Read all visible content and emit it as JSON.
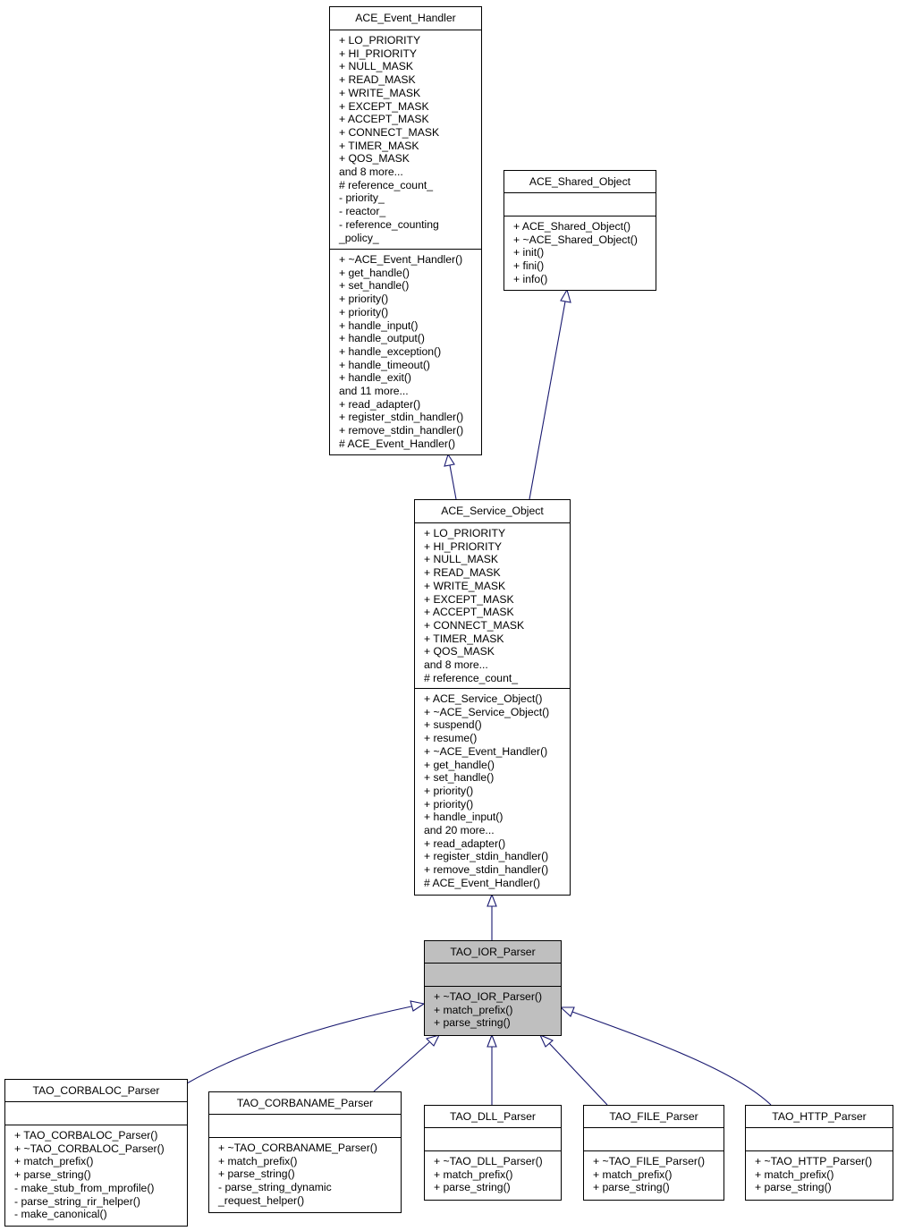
{
  "diagram": {
    "type": "class-inheritance-graph",
    "focus_class": "TAO_IOR_Parser",
    "edge_color": "#191970",
    "focus_fill": "#bfbfbf",
    "classes": {
      "ace_event_handler": {
        "name": "ACE_Event_Handler",
        "attributes": [
          "+ LO_PRIORITY",
          "+ HI_PRIORITY",
          "+ NULL_MASK",
          "+ READ_MASK",
          "+ WRITE_MASK",
          "+ EXCEPT_MASK",
          "+ ACCEPT_MASK",
          "+ CONNECT_MASK",
          "+ TIMER_MASK",
          "+ QOS_MASK",
          "and 8 more...",
          "# reference_count_",
          "- priority_",
          "- reactor_",
          "- reference_counting",
          "_policy_"
        ],
        "methods": [
          "+ ~ACE_Event_Handler()",
          "+ get_handle()",
          "+ set_handle()",
          "+ priority()",
          "+ priority()",
          "+ handle_input()",
          "+ handle_output()",
          "+ handle_exception()",
          "+ handle_timeout()",
          "+ handle_exit()",
          "and 11 more...",
          "+ read_adapter()",
          "+ register_stdin_handler()",
          "+ remove_stdin_handler()",
          "# ACE_Event_Handler()"
        ]
      },
      "ace_shared_object": {
        "name": "ACE_Shared_Object",
        "attributes": [],
        "methods": [
          "+ ACE_Shared_Object()",
          "+ ~ACE_Shared_Object()",
          "+ init()",
          "+ fini()",
          "+ info()"
        ]
      },
      "ace_service_object": {
        "name": "ACE_Service_Object",
        "attributes": [
          "+ LO_PRIORITY",
          "+ HI_PRIORITY",
          "+ NULL_MASK",
          "+ READ_MASK",
          "+ WRITE_MASK",
          "+ EXCEPT_MASK",
          "+ ACCEPT_MASK",
          "+ CONNECT_MASK",
          "+ TIMER_MASK",
          "+ QOS_MASK",
          "and 8 more...",
          "# reference_count_"
        ],
        "methods": [
          "+ ACE_Service_Object()",
          "+ ~ACE_Service_Object()",
          "+ suspend()",
          "+ resume()",
          "+ ~ACE_Event_Handler()",
          "+ get_handle()",
          "+ set_handle()",
          "+ priority()",
          "+ priority()",
          "+ handle_input()",
          "and 20 more...",
          "+ read_adapter()",
          "+ register_stdin_handler()",
          "+ remove_stdin_handler()",
          "# ACE_Event_Handler()"
        ]
      },
      "tao_ior_parser": {
        "name": "TAO_IOR_Parser",
        "attributes": [],
        "methods": [
          "+ ~TAO_IOR_Parser()",
          "+ match_prefix()",
          "+ parse_string()"
        ]
      },
      "tao_corbaloc_parser": {
        "name": "TAO_CORBALOC_Parser",
        "attributes": [],
        "methods": [
          "+ TAO_CORBALOC_Parser()",
          "+ ~TAO_CORBALOC_Parser()",
          "+ match_prefix()",
          "+ parse_string()",
          "- make_stub_from_mprofile()",
          "- parse_string_rir_helper()",
          "- make_canonical()"
        ]
      },
      "tao_corbaname_parser": {
        "name": "TAO_CORBANAME_Parser",
        "attributes": [],
        "methods": [
          "+ ~TAO_CORBANAME_Parser()",
          "+ match_prefix()",
          "+ parse_string()",
          "- parse_string_dynamic",
          "_request_helper()"
        ]
      },
      "tao_dll_parser": {
        "name": "TAO_DLL_Parser",
        "attributes": [],
        "methods": [
          "+ ~TAO_DLL_Parser()",
          "+ match_prefix()",
          "+ parse_string()"
        ]
      },
      "tao_file_parser": {
        "name": "TAO_FILE_Parser",
        "attributes": [],
        "methods": [
          "+ ~TAO_FILE_Parser()",
          "+ match_prefix()",
          "+ parse_string()"
        ]
      },
      "tao_http_parser": {
        "name": "TAO_HTTP_Parser",
        "attributes": [],
        "methods": [
          "+ ~TAO_HTTP_Parser()",
          "+ match_prefix()",
          "+ parse_string()"
        ]
      }
    },
    "edges": [
      {
        "from": "ace_service_object",
        "to": "ace_event_handler",
        "kind": "inherits"
      },
      {
        "from": "ace_service_object",
        "to": "ace_shared_object",
        "kind": "inherits"
      },
      {
        "from": "tao_ior_parser",
        "to": "ace_service_object",
        "kind": "inherits"
      },
      {
        "from": "tao_corbaloc_parser",
        "to": "tao_ior_parser",
        "kind": "inherits"
      },
      {
        "from": "tao_corbaname_parser",
        "to": "tao_ior_parser",
        "kind": "inherits"
      },
      {
        "from": "tao_dll_parser",
        "to": "tao_ior_parser",
        "kind": "inherits"
      },
      {
        "from": "tao_file_parser",
        "to": "tao_ior_parser",
        "kind": "inherits"
      },
      {
        "from": "tao_http_parser",
        "to": "tao_ior_parser",
        "kind": "inherits"
      }
    ]
  }
}
